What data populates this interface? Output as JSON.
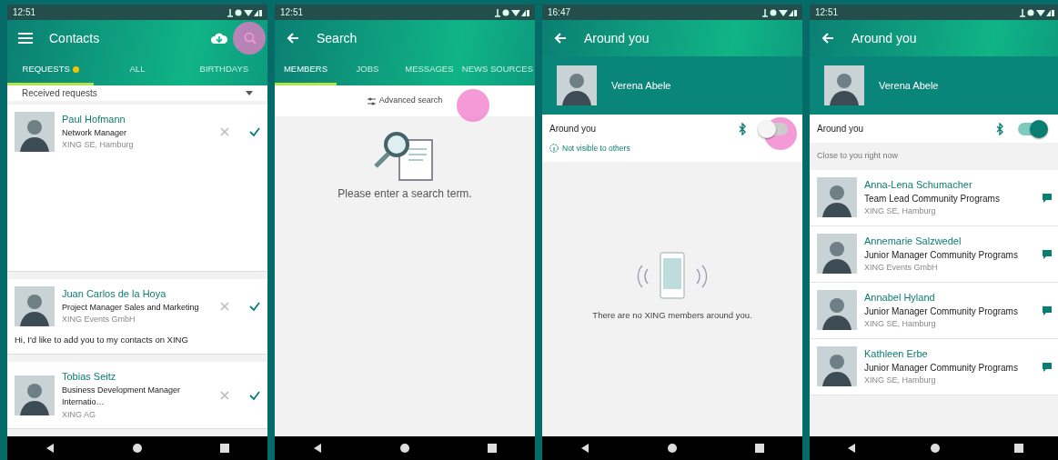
{
  "phones": [
    {
      "kind": "contacts",
      "status_time": "12:51",
      "title": "Contacts",
      "tabs": [
        {
          "label": "REQUESTS",
          "selected": true,
          "dot": true
        },
        {
          "label": "ALL",
          "selected": false,
          "dot": false
        },
        {
          "label": "BIRTHDAYS",
          "selected": false,
          "dot": false
        }
      ],
      "filter": "Received requests",
      "contacts": [
        {
          "name": "Paul Hofmann",
          "headline": "Network Manager",
          "company": "XING SE, Hamburg"
        },
        {
          "name": "Juan Carlos de la Hoya",
          "headline": "Project Manager Sales and Marketing",
          "company": "XING Events GmbH",
          "note": "Hi, I'd like to add you to my contacts on XING"
        },
        {
          "name": "Tobias Seitz",
          "headline": "Business Development Manager Internatio…",
          "company": "XING AG"
        }
      ],
      "touch": true
    },
    {
      "kind": "search",
      "status_time": "12:51",
      "title": "Search",
      "tabs": [
        {
          "label": "MEMBERS",
          "selected": true
        },
        {
          "label": "JOBS",
          "selected": false
        },
        {
          "label": "MESSAGES",
          "selected": false
        },
        {
          "label": "NEWS SOURCES",
          "selected": false
        }
      ],
      "advanced": "Advanced search",
      "empty_text": "Please enter a search term."
    },
    {
      "kind": "around",
      "status_time": "16:47",
      "title": "Around you",
      "profile_name": "Verena Abele",
      "section_label": "Around you",
      "toggle_on": false,
      "hint": "Not visible to others",
      "empty_text": "There are no XING members around you."
    },
    {
      "kind": "around",
      "status_time": "12:51",
      "title": "Around you",
      "profile_name": "Verena Abele",
      "section_label": "Around you",
      "toggle_on": true,
      "list_header": "Close to you right now",
      "people": [
        {
          "name": "Anna-Lena Schumacher",
          "headline": "Team Lead Community Programs",
          "company": "XING SE, Hamburg"
        },
        {
          "name": "Annemarie Salzwedel",
          "headline": "Junior Manager Community Programs",
          "company": "XING Events GmbH"
        },
        {
          "name": "Annabel Hyland",
          "headline": "Junior Manager Community Programs",
          "company": "XING SE, Hamburg"
        },
        {
          "name": "Kathleen Erbe",
          "headline": "Junior Manager Community Programs",
          "company": "XING SE, Hamburg"
        }
      ]
    }
  ]
}
